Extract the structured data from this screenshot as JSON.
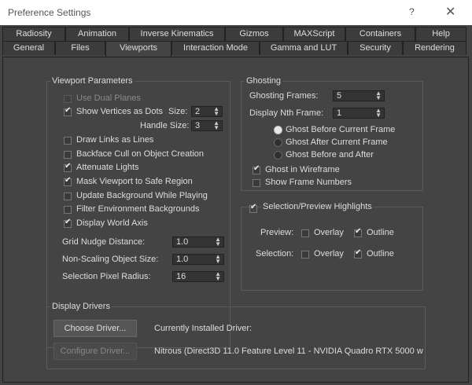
{
  "window": {
    "title": "Preference Settings",
    "help": "?",
    "close": "✕"
  },
  "tabs_row1": [
    "Radiosity",
    "Animation",
    "Inverse Kinematics",
    "Gizmos",
    "MAXScript",
    "Containers",
    "Help"
  ],
  "tabs_row2": [
    "General",
    "Files",
    "Viewports",
    "Interaction Mode",
    "Gamma and LUT",
    "Security",
    "Rendering"
  ],
  "viewport_params": {
    "title": "Viewport Parameters",
    "use_dual_planes": "Use Dual Planes",
    "show_vertices": "Show Vertices as Dots",
    "size_label": "Size:",
    "size_value": "2",
    "handle_size_label": "Handle Size:",
    "handle_size_value": "3",
    "draw_links": "Draw Links as Lines",
    "backface_cull": "Backface Cull on Object Creation",
    "attenuate": "Attenuate Lights",
    "mask_viewport": "Mask Viewport to Safe Region",
    "update_bg": "Update Background While Playing",
    "filter_env": "Filter Environment Backgrounds",
    "display_axis": "Display World Axis",
    "grid_nudge_label": "Grid Nudge Distance:",
    "grid_nudge_value": "1.0",
    "nonscaling_label": "Non-Scaling Object Size:",
    "nonscaling_value": "1.0",
    "pixel_radius_label": "Selection Pixel Radius:",
    "pixel_radius_value": "16"
  },
  "ghosting": {
    "title": "Ghosting",
    "frames_label": "Ghosting Frames:",
    "frames_value": "5",
    "nth_label": "Display Nth Frame:",
    "nth_value": "1",
    "before": "Ghost Before Current Frame",
    "after": "Ghost After Current Frame",
    "before_after": "Ghost Before and After",
    "wireframe": "Ghost in Wireframe",
    "frame_numbers": "Show Frame Numbers"
  },
  "highlights": {
    "title": "Selection/Preview Highlights",
    "preview_label": "Preview:",
    "selection_label": "Selection:",
    "overlay": "Overlay",
    "outline": "Outline"
  },
  "drivers": {
    "title": "Display Drivers",
    "choose": "Choose Driver...",
    "configure": "Configure Driver...",
    "installed_label": "Currently Installed Driver:",
    "installed_value": "Nitrous (Direct3D 11.0 Feature Level 11 - NVIDIA Quadro RTX 5000 w"
  }
}
